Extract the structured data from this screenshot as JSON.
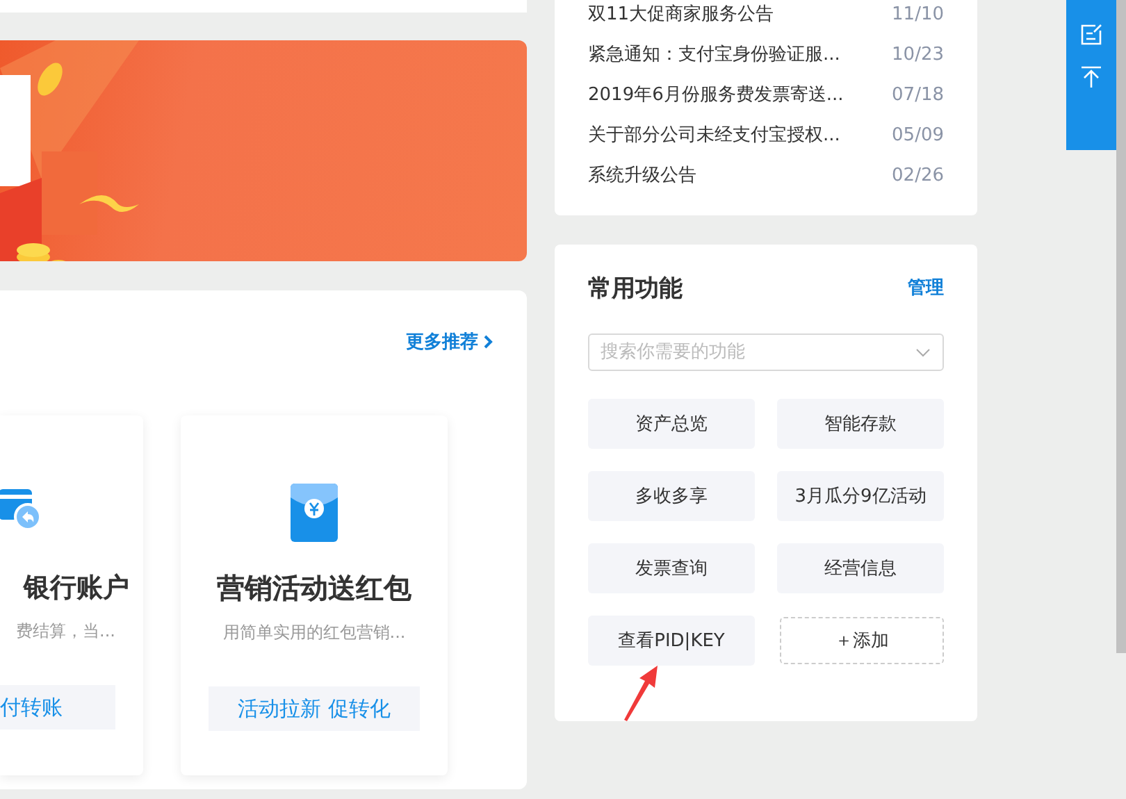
{
  "recommend": {
    "more_link": "更多推荐",
    "cards": [
      {
        "title": "银行账户",
        "description": "费结算，当...",
        "action": "付转账"
      },
      {
        "title": "营销活动送红包",
        "description": "用简单实用的红包营销...",
        "action": "活动拉新 促转化"
      }
    ]
  },
  "notices": [
    {
      "title": "双11大促商家服务公告",
      "date": "11/10"
    },
    {
      "title": "紧急通知：支付宝身份验证服...",
      "date": "10/23"
    },
    {
      "title": "2019年6月份服务费发票寄送...",
      "date": "07/18"
    },
    {
      "title": "关于部分公司未经支付宝授权...",
      "date": "05/09"
    },
    {
      "title": "系统升级公告",
      "date": "02/26"
    }
  ],
  "functions": {
    "title": "常用功能",
    "manage": "管理",
    "search": {
      "placeholder": "搜索你需要的功能"
    },
    "items": [
      {
        "label": "资产总览",
        "kind": "function"
      },
      {
        "label": "智能存款",
        "kind": "function"
      },
      {
        "label": "多收多享",
        "kind": "function"
      },
      {
        "label": "3月瓜分9亿活动",
        "kind": "function"
      },
      {
        "label": "发票查询",
        "kind": "function"
      },
      {
        "label": "经营信息",
        "kind": "function"
      },
      {
        "label": "查看PID|KEY",
        "kind": "function"
      },
      {
        "label": "＋添加",
        "kind": "add"
      }
    ]
  }
}
